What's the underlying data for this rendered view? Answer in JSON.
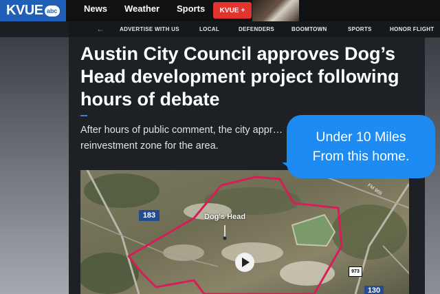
{
  "header": {
    "logo_text": "KVUE",
    "logo_badge": "abc",
    "nav": [
      "News",
      "Weather",
      "Sports"
    ],
    "plus_label": "KVUE",
    "plus_symbol": "+"
  },
  "subnav": {
    "items": [
      "ADVERTISE WITH US",
      "LOCAL",
      "DEFENDERS",
      "BOOMTOWN",
      "SPORTS",
      "HONOR FLIGHT"
    ]
  },
  "article": {
    "headline": "Austin City Council approves Dog’s Head development project following hours of debate",
    "subhead": "After hours of public comment, the city appr… reinvestment zone for the area."
  },
  "map": {
    "place_label": "Dog's Head",
    "highway_183": "183",
    "highway_130": "130",
    "road_973": "973",
    "road_fm969": "FM 969"
  },
  "overlay": {
    "line1": "Under 10 Miles",
    "line2": "From this home."
  },
  "colors": {
    "brand_blue": "#1f5fb8",
    "plus_red": "#e0342f",
    "bubble_blue": "#1e8bf2",
    "boundary": "#d61d57"
  }
}
